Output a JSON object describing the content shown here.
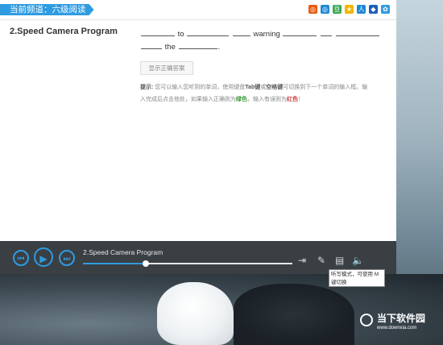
{
  "breadcrumb": "当前频道：六级阅读",
  "share_icons": [
    {
      "name": "rss-icon",
      "color": "#e8590c",
      "glyph": "◎"
    },
    {
      "name": "weibo-icon",
      "color": "#1f88d6",
      "glyph": "◎"
    },
    {
      "name": "douban-icon",
      "color": "#3aa655",
      "glyph": "豆"
    },
    {
      "name": "qq-zone-icon",
      "color": "#f2b700",
      "glyph": "★"
    },
    {
      "name": "renren-icon",
      "color": "#1f88d6",
      "glyph": "人"
    },
    {
      "name": "qq-icon",
      "color": "#1d5fb7",
      "glyph": "◆"
    },
    {
      "name": "sina-icon",
      "color": "#2f9be0",
      "glyph": "✿"
    }
  ],
  "question": {
    "title": "2.Speed Camera Program",
    "words": {
      "to": "to",
      "warning": "warning",
      "the": "the",
      "end": "."
    },
    "show_answer_label": "显示正确答案",
    "hint_prefix": "提示:",
    "hint_text_1": " 您可以输入您听到的单词，使用键盘",
    "hint_key1": "Tab键",
    "hint_text_2": "或",
    "hint_key2": "空格键",
    "hint_text_3": "可切换到下一个单词的输入框。输入完成后点击他处，如果输入正确则为",
    "hint_green": "绿色",
    "hint_text_4": "，输入有误则为",
    "hint_red": "红色",
    "hint_text_5": "！"
  },
  "player": {
    "track_title": "2.Speed Camera Program",
    "progress_percent": 30,
    "tooltip": "听写模式，可使用 M 键切换"
  },
  "watermark": {
    "title": "当下软件园",
    "sub": "www.downxia.com"
  }
}
